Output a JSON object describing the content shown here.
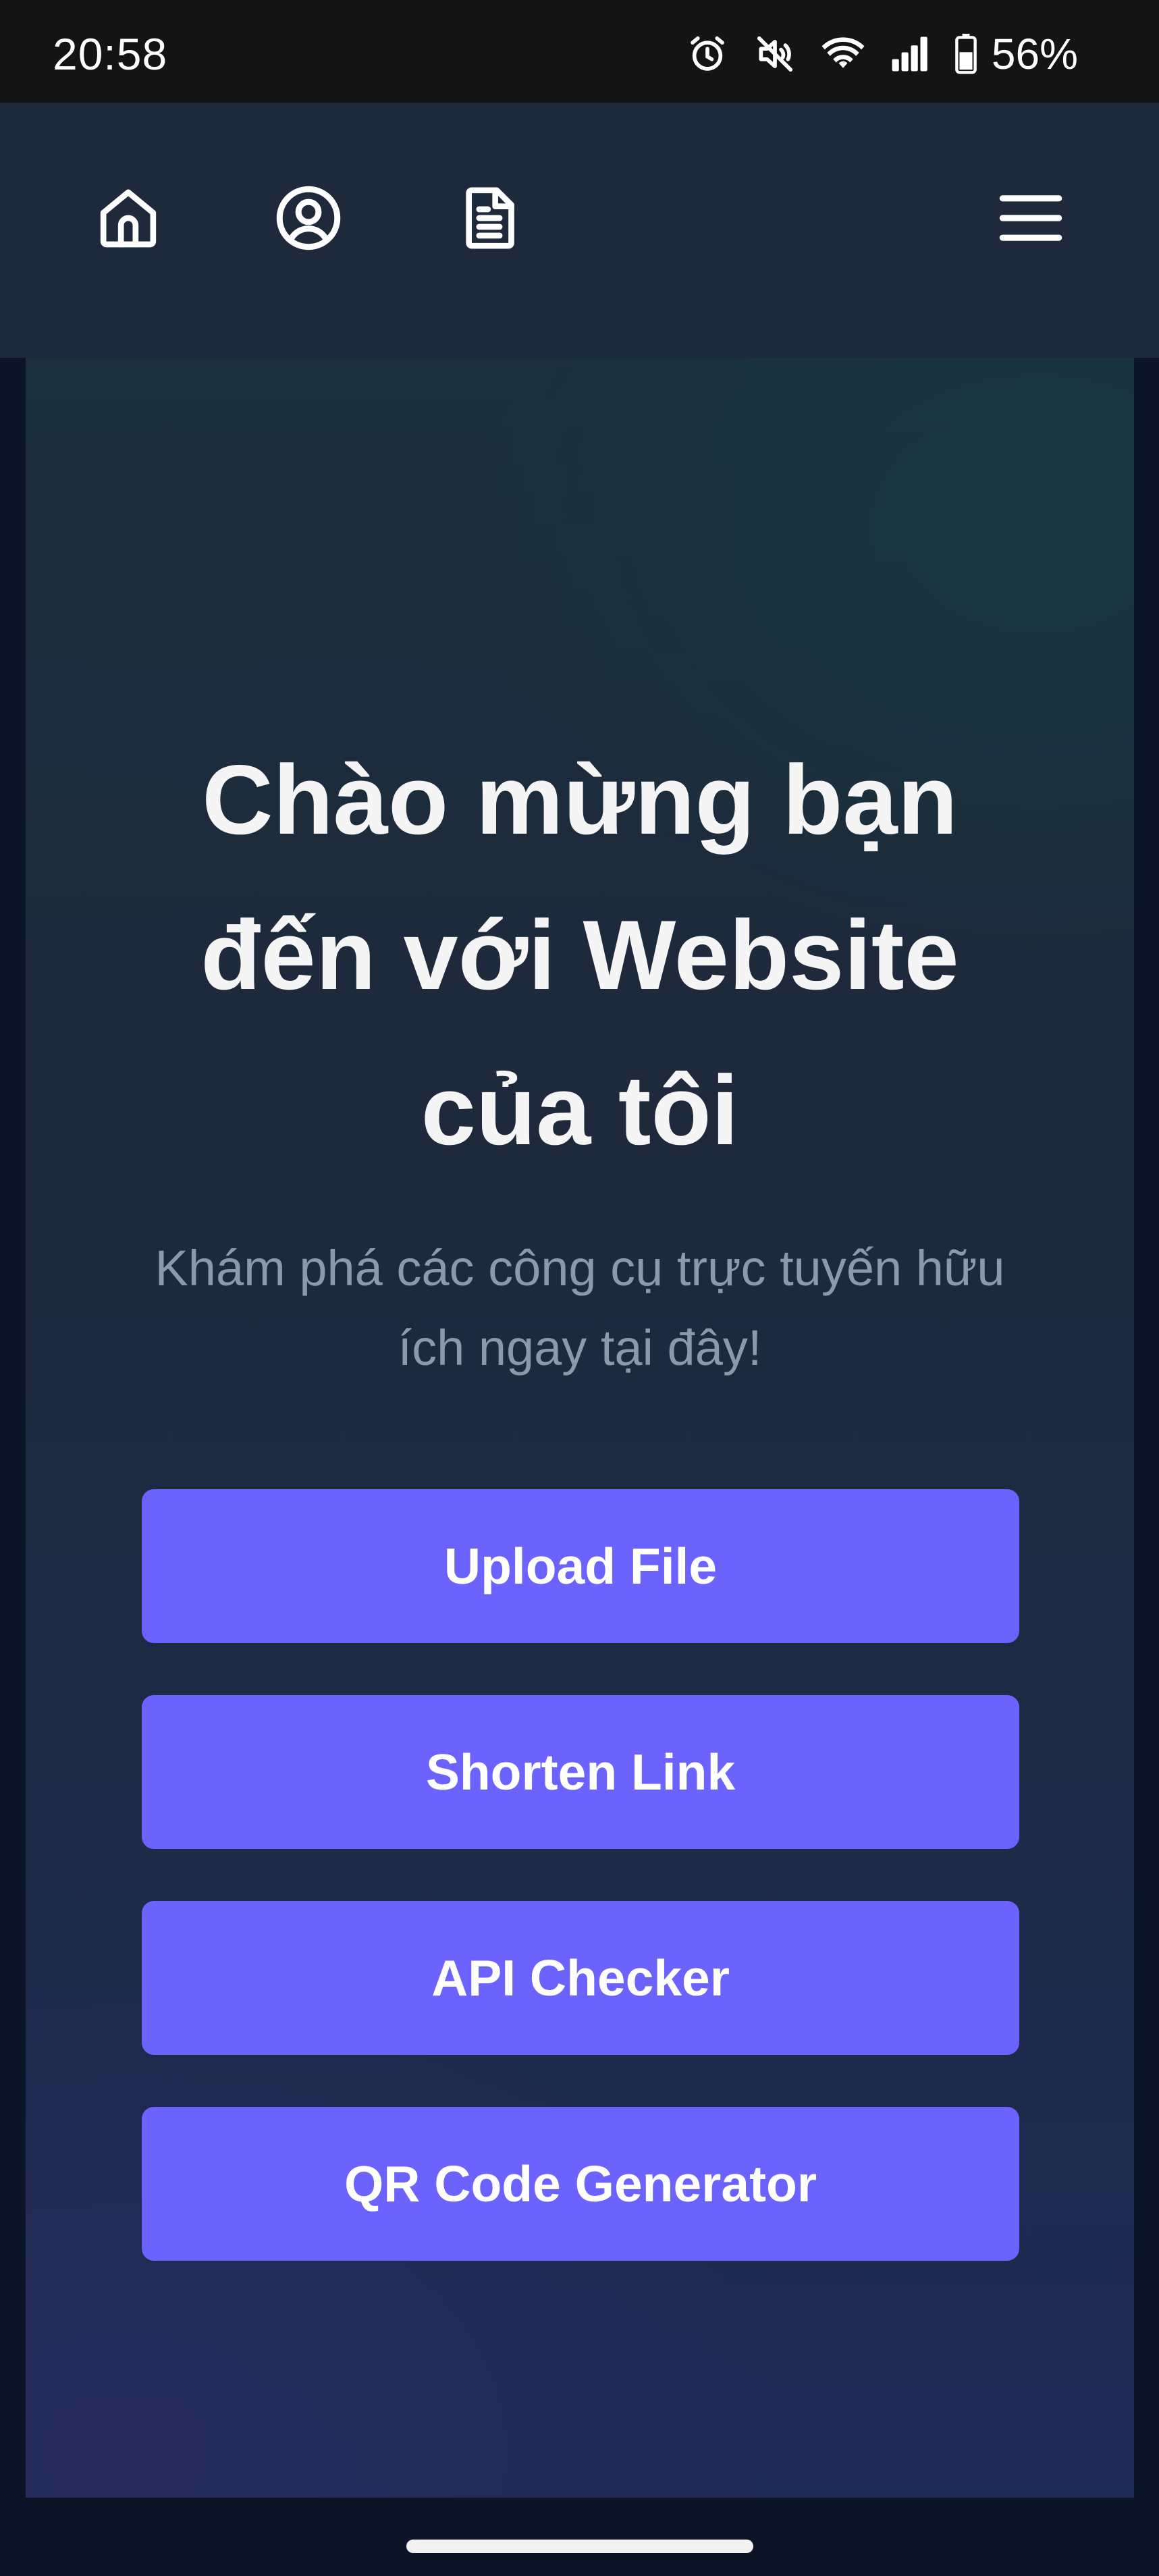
{
  "status_bar": {
    "time": "20:58",
    "battery_percent": "56%",
    "icons": [
      "alarm-icon",
      "mute-icon",
      "wifi-icon",
      "signal-icon",
      "battery-icon"
    ]
  },
  "navbar": {
    "icons": [
      "home-icon",
      "user-icon",
      "document-icon",
      "menu-icon"
    ]
  },
  "hero": {
    "title": "Chào mừng bạn đến với Website của tôi",
    "subtitle": "Khám phá các công cụ trực tuyến hữu ích ngay tại đây!"
  },
  "buttons": [
    {
      "label": "Upload File"
    },
    {
      "label": "Shorten Link"
    },
    {
      "label": "API Checker"
    },
    {
      "label": "QR Code Generator"
    }
  ],
  "colors": {
    "accent": "#6c63ff",
    "navbar": "#1e293b",
    "status_bar": "#141414",
    "title_text": "#f5f5f5",
    "subtitle_text": "#8e98ab"
  }
}
